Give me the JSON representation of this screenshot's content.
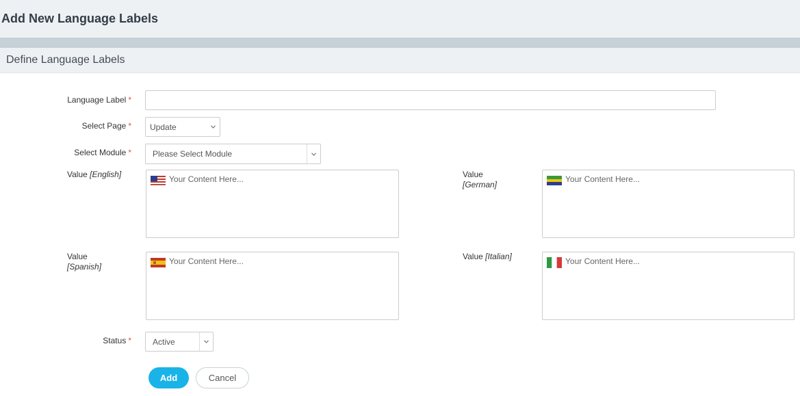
{
  "page": {
    "title": "Add New Language Labels"
  },
  "section": {
    "title": "Define Language Labels"
  },
  "form": {
    "language_label": {
      "label": "Language Label",
      "required": "*",
      "value": ""
    },
    "select_page": {
      "label": "Select Page",
      "required": "*",
      "value": "Update"
    },
    "select_module": {
      "label": "Select Module",
      "required": "*",
      "value": "Please Select Module"
    },
    "values": {
      "prefix": "Value",
      "english": {
        "lang": "[English]",
        "placeholder": "Your Content Here...",
        "flag": "us-flag-icon"
      },
      "german": {
        "lang": "[German]",
        "placeholder": "Your Content Here...",
        "flag": "german-flag-icon"
      },
      "spanish": {
        "lang": "[Spanish]",
        "placeholder": "Your Content Here...",
        "flag": "spanish-flag-icon"
      },
      "italian": {
        "lang": "[Italian]",
        "placeholder": "Your Content Here...",
        "flag": "italian-flag-icon"
      }
    },
    "status": {
      "label": "Status",
      "required": "*",
      "value": "Active"
    }
  },
  "buttons": {
    "add": "Add",
    "cancel": "Cancel"
  },
  "colors": {
    "accent": "#1ab3e8",
    "required": "#d9534f",
    "header_bg": "#eef1f4",
    "divider": "#c6d1d7"
  }
}
